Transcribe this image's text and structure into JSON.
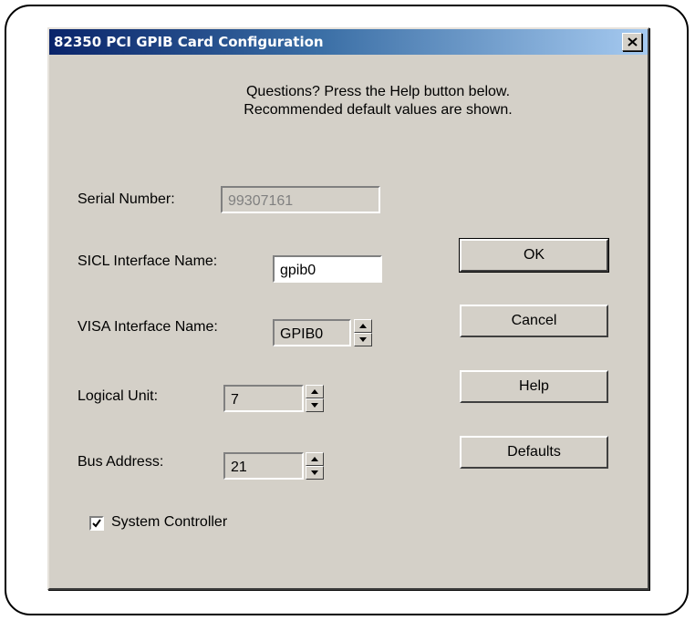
{
  "dialog": {
    "title": "82350 PCI GPIB Card Configuration",
    "close_glyph": "✕"
  },
  "info": {
    "line1": "Questions?  Press the Help button below.",
    "line2": "Recommended default values are shown."
  },
  "fields": {
    "serial_number": {
      "label": "Serial Number:",
      "value": "99307161"
    },
    "sicl_name": {
      "label": "SICL Interface Name:",
      "value": "gpib0"
    },
    "visa_name": {
      "label": "VISA Interface Name:",
      "value": "GPIB0"
    },
    "logical_unit": {
      "label": "Logical Unit:",
      "value": "7"
    },
    "bus_address": {
      "label": "Bus Address:",
      "value": "21"
    }
  },
  "checkbox": {
    "label": "System Controller",
    "checked": true
  },
  "buttons": {
    "ok": "OK",
    "cancel": "Cancel",
    "help": "Help",
    "defaults": "Defaults"
  },
  "colors": {
    "dialog_face": "#d4d0c8",
    "title_start": "#0a246a",
    "title_end": "#a6caf0",
    "disabled_text": "#808080"
  },
  "icons": {
    "close": "close-icon",
    "spin_up": "arrow-up-icon",
    "spin_down": "arrow-down-icon",
    "check": "checkmark-icon"
  }
}
